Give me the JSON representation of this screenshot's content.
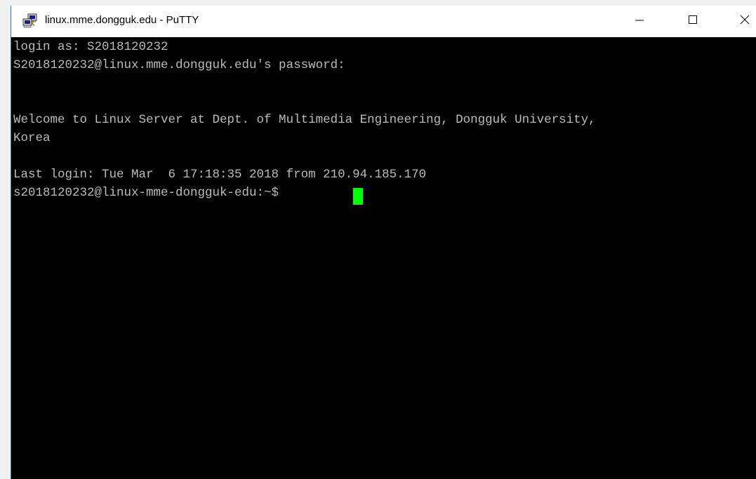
{
  "window": {
    "title": "linux.mme.dongguk.edu - PuTTY",
    "app_icon": "putty-icon",
    "controls": {
      "minimize_icon": "minimize-icon",
      "maximize_icon": "maximize-icon",
      "close_icon": "close-icon"
    }
  },
  "terminal": {
    "background_color": "#000000",
    "text_color": "#bbbbbb",
    "cursor_color": "#00ff00",
    "lines": [
      "login as: S2018120232",
      "S2018120232@linux.mme.dongguk.edu's password:",
      "",
      "",
      "Welcome to Linux Server at Dept. of Multimedia Engineering, Dongguk University,",
      "Korea",
      "",
      "Last login: Tue Mar  6 17:18:35 2018 from 210.94.185.170",
      "s2018120232@linux-mme-dongguk-edu:~$ "
    ]
  }
}
